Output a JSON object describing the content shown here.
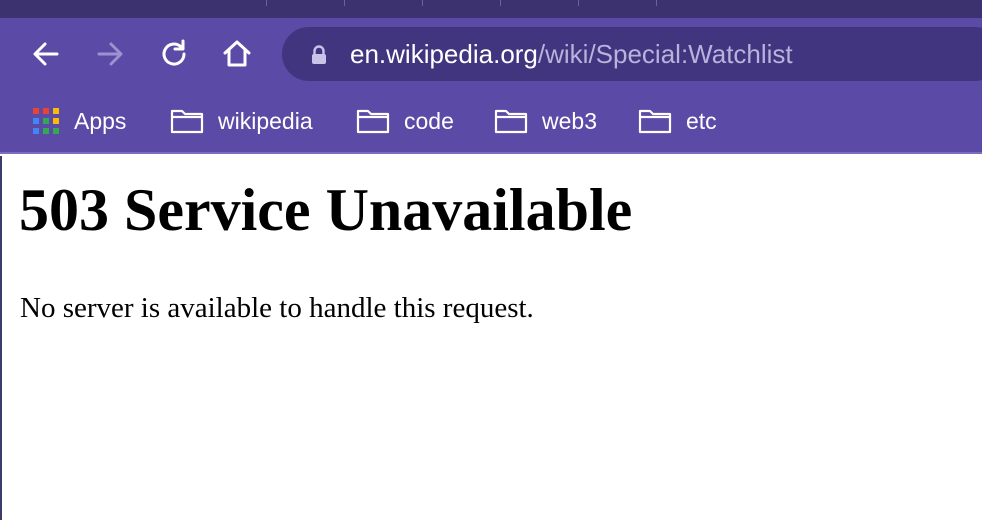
{
  "browser": {
    "nav": {
      "back_icon": "arrow-left-icon",
      "forward_icon": "arrow-right-icon",
      "reload_icon": "reload-icon",
      "home_icon": "home-icon"
    },
    "address_bar": {
      "lock_icon": "lock-icon",
      "host": "en.wikipedia.org",
      "path": "/wiki/Special:Watchlist"
    },
    "bookmarks": [
      {
        "label": "Apps",
        "icon": "apps-grid-icon"
      },
      {
        "label": "wikipedia",
        "icon": "folder-icon"
      },
      {
        "label": "code",
        "icon": "folder-icon"
      },
      {
        "label": "web3",
        "icon": "folder-icon"
      },
      {
        "label": "etc",
        "icon": "folder-icon"
      }
    ],
    "colors": {
      "tabstrip": "#3d3270",
      "toolbar": "#5b4aa6",
      "omnibox": "#40357e",
      "url_path": "#b9b2dc"
    }
  },
  "page": {
    "heading": "503 Service Unavailable",
    "message": "No server is available to handle this request."
  }
}
